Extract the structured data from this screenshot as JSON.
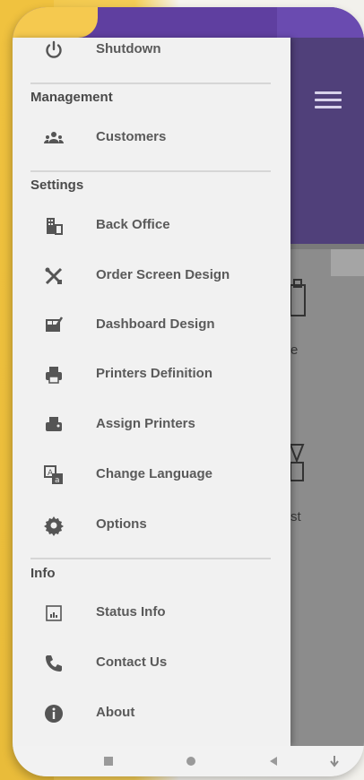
{
  "drawer": {
    "top_item": {
      "label": "Shutdown",
      "icon": "power-icon"
    },
    "sections": [
      {
        "title": "Management",
        "items": [
          {
            "label": "Customers",
            "icon": "customers-icon"
          }
        ]
      },
      {
        "title": "Settings",
        "items": [
          {
            "label": "Back Office",
            "icon": "back-office-icon"
          },
          {
            "label": "Order Screen Design",
            "icon": "tools-icon"
          },
          {
            "label": "Dashboard Design",
            "icon": "dashboard-design-icon"
          },
          {
            "label": "Printers Definition",
            "icon": "printer-icon"
          },
          {
            "label": "Assign Printers",
            "icon": "assign-printer-icon"
          },
          {
            "label": "Change Language",
            "icon": "language-icon"
          },
          {
            "label": "Options",
            "icon": "gear-icon"
          }
        ]
      },
      {
        "title": "Info",
        "items": [
          {
            "label": "Status Info",
            "icon": "status-info-icon"
          },
          {
            "label": "Contact Us",
            "icon": "phone-icon"
          },
          {
            "label": "About",
            "icon": "info-icon"
          }
        ]
      }
    ]
  },
  "background_app": {
    "tile_labels": [
      "e",
      "st"
    ]
  },
  "colors": {
    "header_purple": "#50407a",
    "accent_yellow": "#f1c64a",
    "drawer_bg": "#f1f1f1",
    "icon_color": "#555555"
  }
}
